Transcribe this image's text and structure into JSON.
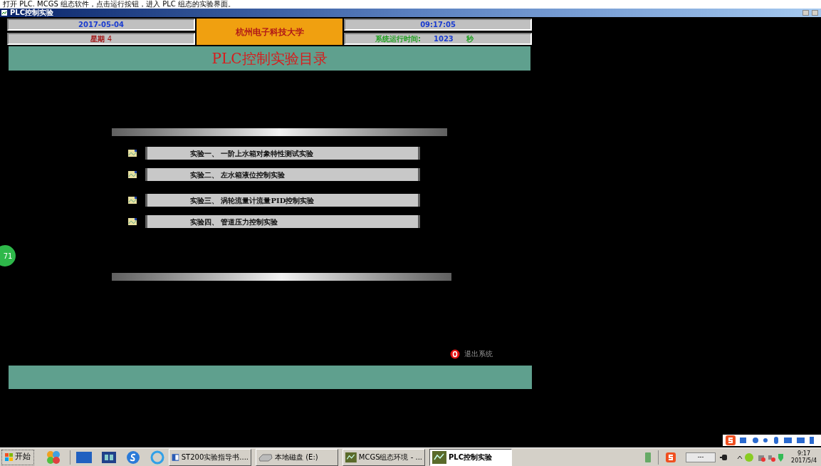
{
  "caption": "打开 PLC. MCGS 组态软件，点击运行按钮，进入 PLC 组态的实验界面。",
  "window": {
    "title": "PLC控制实验"
  },
  "header": {
    "date": "2017-05-04",
    "weekday_label": "星期",
    "weekday": "4",
    "school": "杭州电子科技大学",
    "time": "09:17:05",
    "runtime_label": "系统运行时间:",
    "runtime_value": "1023",
    "runtime_unit": "秒"
  },
  "banner": "PLC控制实验目录",
  "experiments": [
    {
      "label": "实验一、  一阶上水箱对象特性测试实验"
    },
    {
      "label": "实验二、  左水箱液位控制实验"
    },
    {
      "label": "实验三、  涡轮流量计流量PID控制实验"
    },
    {
      "label": "实验四、  管道压力控制实验"
    }
  ],
  "side_badge": "71",
  "exit": "退出系统",
  "taskbar": {
    "start": "开始",
    "tasks": [
      {
        "kind": "doc",
        "label": "ST200实验指导书....",
        "selected": false
      },
      {
        "kind": "disk",
        "label": "本地磁盘 (E:)",
        "selected": false
      },
      {
        "kind": "app",
        "label": "MCGS组态环境 - ...",
        "selected": false
      },
      {
        "kind": "app",
        "label": "PLC控制实验",
        "selected": true
      }
    ],
    "tray_field": "---",
    "clock_time": "9:17",
    "clock_date": "2017/5/4"
  }
}
